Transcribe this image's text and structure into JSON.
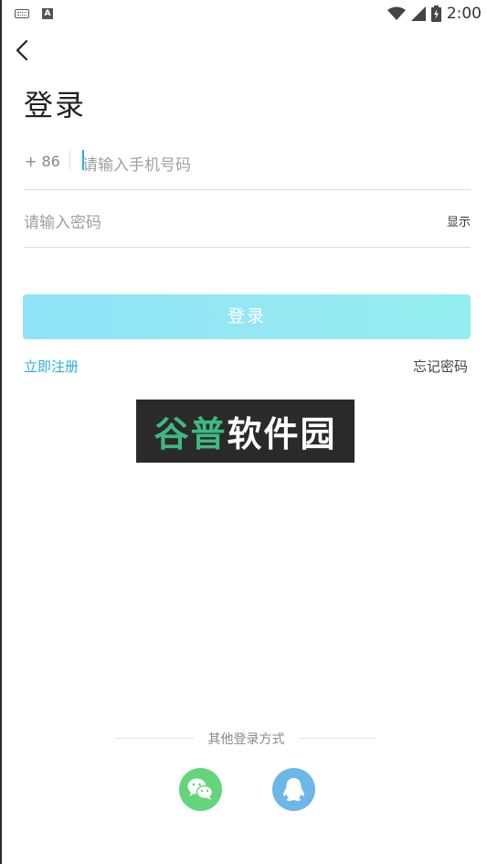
{
  "status_bar": {
    "time": "2:00",
    "icons": [
      "keyboard-icon",
      "a-icon",
      "wifi-icon",
      "signal-icon",
      "battery-icon"
    ]
  },
  "header": {
    "back_icon": "chevron-left-icon"
  },
  "page": {
    "title": "登录"
  },
  "form": {
    "country_code": "+ 86",
    "phone_placeholder": "请输入手机号码",
    "password_placeholder": "请输入密码",
    "show_label": "显示",
    "submit_label": "登录"
  },
  "links": {
    "register": "立即注册",
    "forgot": "忘记密码"
  },
  "watermark": {
    "text_green": "谷普",
    "text_white": "软件园"
  },
  "other_login": {
    "label": "其他登录方式",
    "methods": [
      "wechat-icon",
      "qq-icon"
    ]
  },
  "colors": {
    "accent": "#2ab0d8",
    "button": "#8fe3f6",
    "wechat": "#64d57d",
    "qq": "#6cb7e8"
  }
}
